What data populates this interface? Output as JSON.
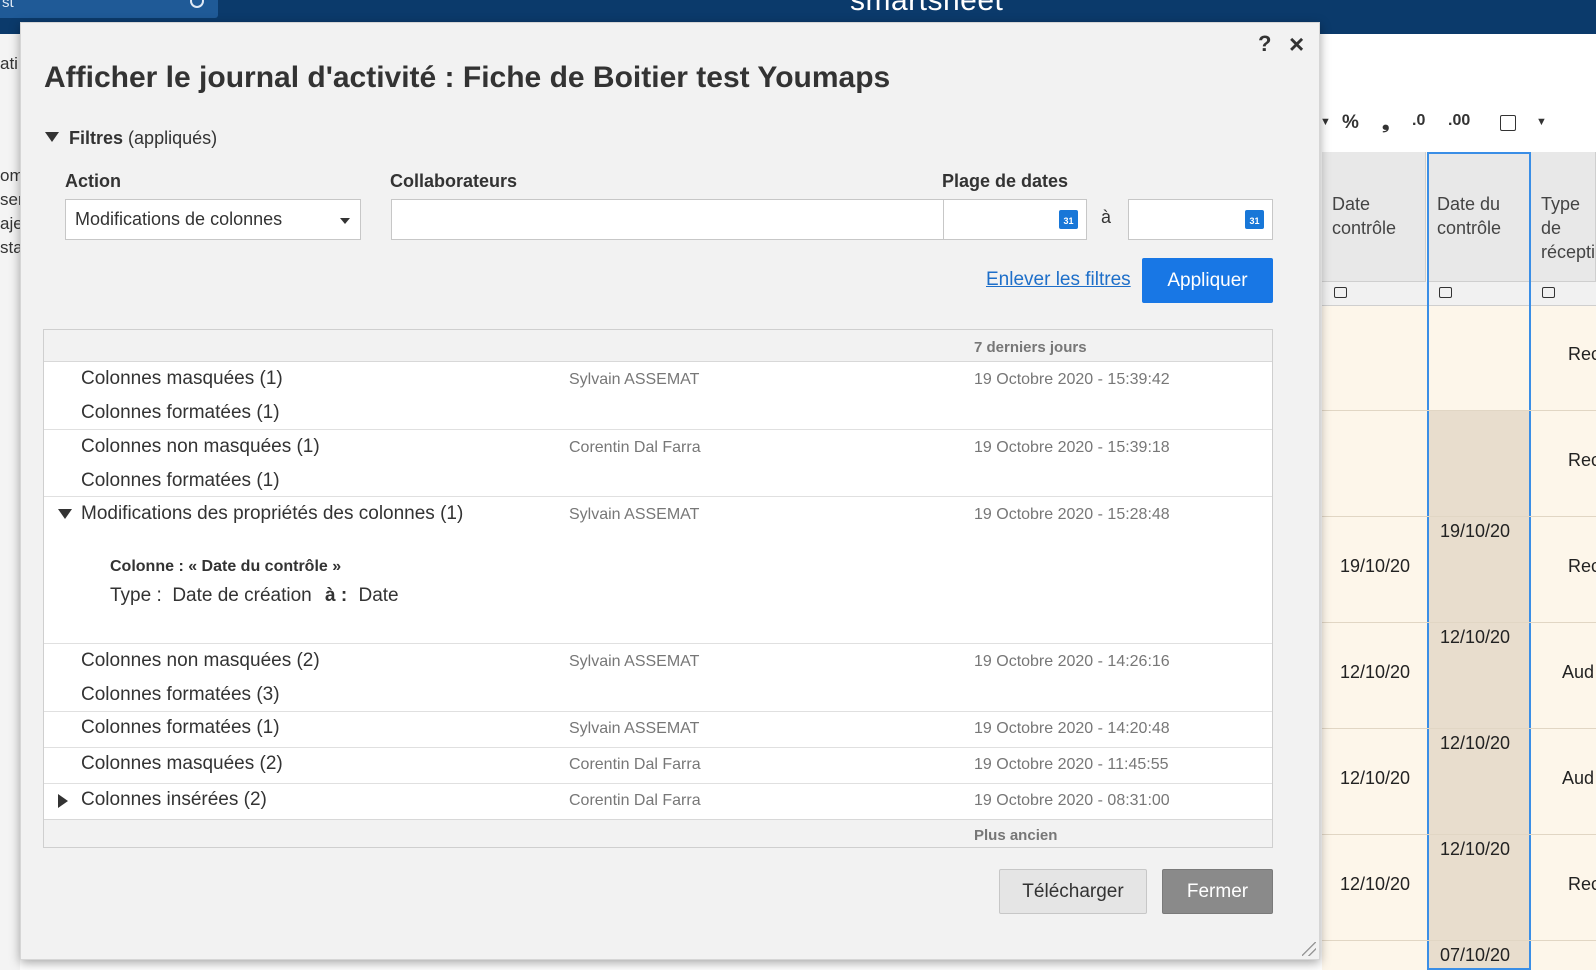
{
  "app": {
    "brand": "smartsheet",
    "search_text": "st"
  },
  "background": {
    "left_edge_text": [
      "ati",
      "om",
      "ser",
      "aje",
      "sta"
    ],
    "toolbar_icons": [
      "dropdown-arrow-icon",
      "percent-icon",
      "comma-icon",
      "decrease-decimal-icon",
      "increase-decimal-icon",
      "calendar-icon",
      "dropdown-arrow-icon"
    ],
    "toolbar_glyphs": {
      "percent": "%",
      "comma": "❟",
      "dec": ".0",
      "inc": ".00"
    },
    "columns": [
      {
        "title_line1": "Date",
        "title_line2": "contrôle"
      },
      {
        "title_line1": "Date du",
        "title_line2": "contrôle"
      },
      {
        "title_line1": "Type de",
        "title_line2": "récepti"
      }
    ],
    "col1_values": [
      "19/10/20",
      "12/10/20",
      "12/10/20",
      "12/10/20"
    ],
    "col2_values": [
      "19/10/20",
      "12/10/20",
      "12/10/20",
      "12/10/20",
      "07/10/20"
    ],
    "col3_values": [
      "Rece",
      "Rece",
      "Rece",
      "Aud",
      "Aud",
      "Rece"
    ]
  },
  "modal": {
    "help": "?",
    "close": "×",
    "title": "Afficher le journal d'activité : Fiche de Boitier test Youmaps",
    "filters_label": "Filtres",
    "filters_state": "(appliqués)",
    "action_label": "Action",
    "action_value": "Modifications de colonnes",
    "collaborators_label": "Collaborateurs",
    "collaborators_value": "",
    "date_range_label": "Plage de dates",
    "date_from": "",
    "date_to": "",
    "date_sep": "à",
    "calendar_day": "31",
    "clear_filters": "Enlever les filtres",
    "apply": "Appliquer",
    "group_recent": "7 derniers jours",
    "group_older": "Plus ancien",
    "entries": [
      {
        "actions": [
          "Colonnes masquées (1)",
          "Colonnes formatées (1)"
        ],
        "user": "Sylvain ASSEMAT",
        "time": "19 Octobre 2020 - 15:39:42"
      },
      {
        "actions": [
          "Colonnes non masquées (1)",
          "Colonnes formatées (1)"
        ],
        "user": "Corentin Dal Farra",
        "time": "19 Octobre 2020 - 15:39:18"
      },
      {
        "actions": [
          "Modifications des propriétés des colonnes (1)"
        ],
        "user": "Sylvain ASSEMAT",
        "time": "19 Octobre 2020 - 15:28:48",
        "expanded": true,
        "detail_heading": "Colonne : « Date du contrôle »",
        "detail_prefix": "Type :",
        "detail_from": "Date de création",
        "detail_to_label": "à :",
        "detail_to": "Date"
      },
      {
        "actions": [
          "Colonnes non masquées (2)",
          "Colonnes formatées (3)"
        ],
        "user": "Sylvain ASSEMAT",
        "time": "19 Octobre 2020 - 14:26:16"
      },
      {
        "actions": [
          "Colonnes formatées (1)"
        ],
        "user": "Sylvain ASSEMAT",
        "time": "19 Octobre 2020 - 14:20:48"
      },
      {
        "actions": [
          "Colonnes masquées (2)"
        ],
        "user": "Corentin Dal Farra",
        "time": "19 Octobre 2020 - 11:45:55"
      },
      {
        "actions": [
          "Colonnes insérées (2)"
        ],
        "user": "Corentin Dal Farra",
        "time": "19 Octobre 2020 - 08:31:00",
        "collapsed": true
      }
    ],
    "download": "Télécharger",
    "close_button": "Fermer"
  }
}
